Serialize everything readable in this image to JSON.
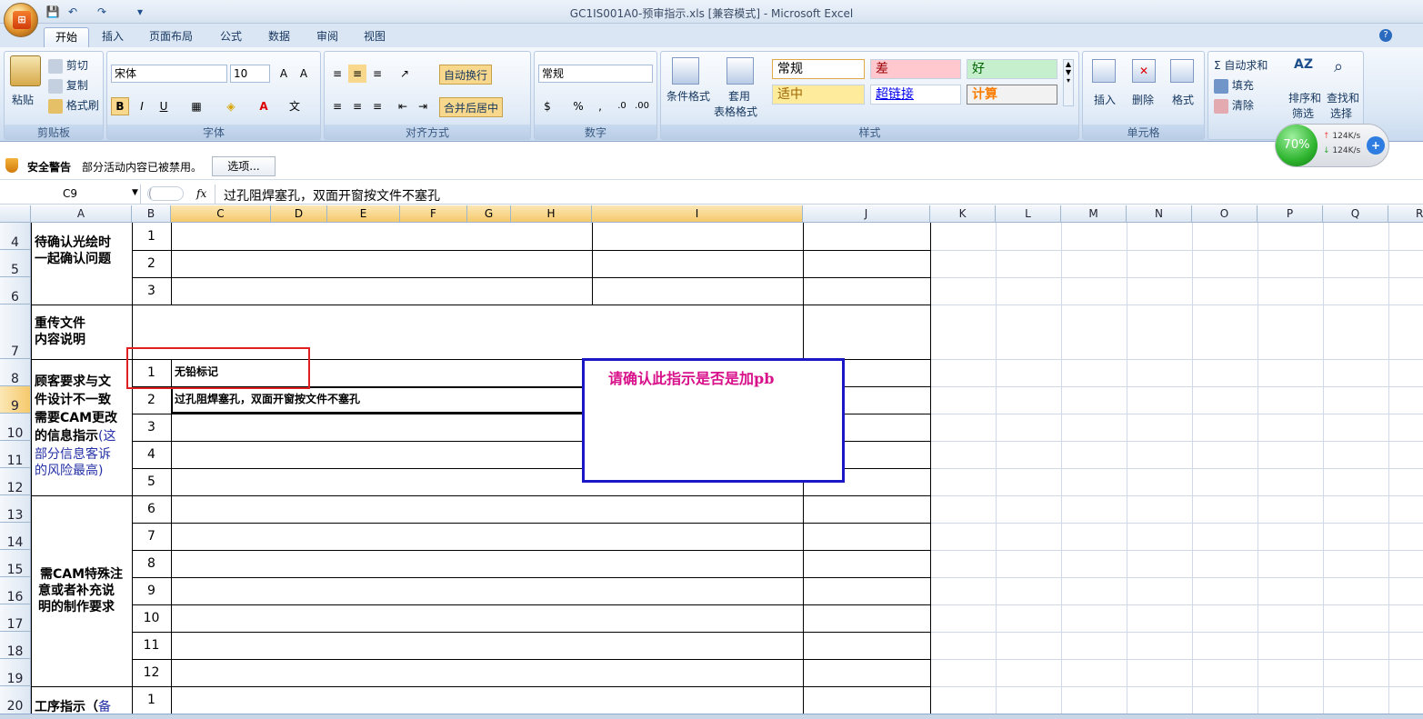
{
  "window": {
    "title": "GC1IS001A0-预审指示.xls  [兼容模式] - Microsoft Excel"
  },
  "tabs": [
    "开始",
    "插入",
    "页面布局",
    "公式",
    "数据",
    "审阅",
    "视图"
  ],
  "ribbon": {
    "clipboard": {
      "paste": "粘贴",
      "cut": "剪切",
      "copy": "复制",
      "format_painter": "格式刷",
      "label": "剪贴板"
    },
    "font": {
      "name": "宋体",
      "size": "10",
      "bold": "B",
      "italic": "I",
      "underline": "U",
      "label": "字体"
    },
    "alignment": {
      "wrap": "自动换行",
      "merge": "合并后居中",
      "label": "对齐方式"
    },
    "number": {
      "format": "常规",
      "percent": "%",
      "comma": ",",
      "label": "数字"
    },
    "styles": {
      "conditional": "条件格式",
      "table1": "套用",
      "table2": "表格格式",
      "normal": "常规",
      "bad": "差",
      "good": "好",
      "neutral": "适中",
      "hyperlink": "超链接",
      "calc": "计算",
      "label": "样式"
    },
    "cells": {
      "insert": "插入",
      "delete": "删除",
      "format": "格式",
      "label": "单元格"
    },
    "editing": {
      "autosum": "自动求和",
      "fill": "填充",
      "clear": "清除",
      "sort1": "排序和",
      "sort2": "筛选",
      "find1": "查找和",
      "find2": "选择"
    }
  },
  "widget": {
    "percent": "70%",
    "up": "124K/s",
    "down": "124K/s"
  },
  "security": {
    "title": "安全警告",
    "message": "部分活动内容已被禁用。",
    "options": "选项..."
  },
  "formula": {
    "namebox": "C9",
    "fx": "fx",
    "content": "过孔阻焊塞孔，双面开窗按文件不塞孔"
  },
  "columns": [
    "A",
    "B",
    "C",
    "D",
    "E",
    "F",
    "G",
    "H",
    "I",
    "J",
    "K",
    "L",
    "M",
    "N",
    "O",
    "P",
    "Q",
    "R"
  ],
  "rows": [
    "4",
    "5",
    "6",
    "7",
    "8",
    "9",
    "10",
    "11",
    "12",
    "13",
    "14",
    "15",
    "16",
    "17",
    "18",
    "19",
    "20"
  ],
  "cells": {
    "a4": "待确认光绘时",
    "a4b": "一起确认问题",
    "a7": "重传文件",
    "a7b": "内容说明",
    "a8": "顾客要求与文",
    "a8b": "件设计不一致",
    "a8c": "需要CAM更改",
    "a8d": "的信息指示",
    "a8e": "(这",
    "a8f": "部分信息客诉",
    "a8g": "的风险最高)",
    "a13": "需CAM特殊注",
    "a13b": "意或者补充说",
    "a13c": "明的制作要求",
    "a20": "工序指示（",
    "a20b": "备",
    "c8": "无铅标记",
    "c9": "过孔阻焊塞孔，双面开窗按文件不塞孔",
    "nums": [
      "1",
      "2",
      "3",
      "1",
      "2",
      "3",
      "4",
      "5",
      "6",
      "7",
      "8",
      "9",
      "10",
      "11",
      "12",
      "1"
    ]
  },
  "annotation": {
    "text": "请确认此指示是否是加pb"
  }
}
